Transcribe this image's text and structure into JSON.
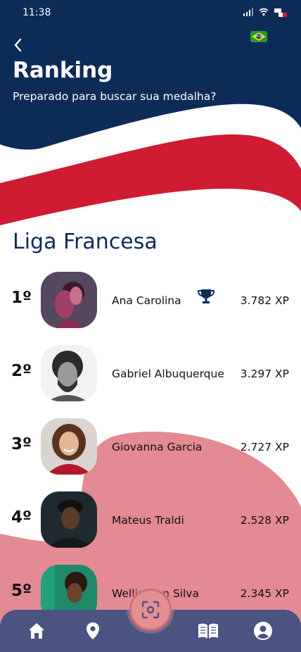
{
  "status_bar": {
    "time": "11:38"
  },
  "header": {
    "title": "Ranking",
    "subtitle": "Preparado para buscar sua medalha?",
    "language_flag": "brazil-flag-icon"
  },
  "league": {
    "title": "Liga Francesa"
  },
  "ranking": [
    {
      "position": "1º",
      "name": "Ana Carolina",
      "xp": "3.782 XP",
      "trophy": true
    },
    {
      "position": "2º",
      "name": "Gabriel Albuquerque",
      "xp": "3.297 XP",
      "trophy": false
    },
    {
      "position": "3º",
      "name": "Giovanna Garcia",
      "xp": "2.727 XP",
      "trophy": false
    },
    {
      "position": "4º",
      "name": "Mateus Traldi",
      "xp": "2.528 XP",
      "trophy": false
    },
    {
      "position": "5º",
      "name": "Wellington Silva",
      "xp": "2.345 XP",
      "trophy": false
    }
  ],
  "nav": {
    "items": [
      "home-icon",
      "location-pin-icon",
      "scan-icon",
      "book-icon",
      "profile-icon"
    ]
  },
  "colors": {
    "navy": "#0d2b57",
    "red": "#d01c33",
    "pink": "#e48a92",
    "nav_bg": "#4b5381"
  }
}
